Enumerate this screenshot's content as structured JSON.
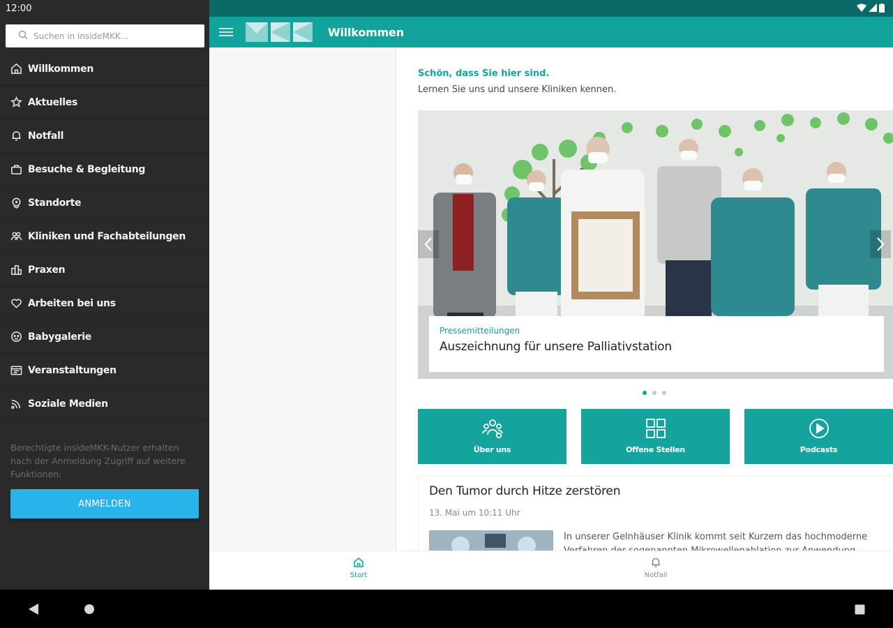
{
  "status": {
    "time": "12:00"
  },
  "search": {
    "placeholder": "Suchen in insideMKK..."
  },
  "nav": {
    "items": [
      {
        "label": "Willkommen",
        "icon": "home-icon"
      },
      {
        "label": "Aktuelles",
        "icon": "star-icon"
      },
      {
        "label": "Notfall",
        "icon": "bell-icon"
      },
      {
        "label": "Besuche & Begleitung",
        "icon": "bag-icon"
      },
      {
        "label": "Standorte",
        "icon": "location-icon"
      },
      {
        "label": "Kliniken und Fachabteilungen",
        "icon": "group-icon"
      },
      {
        "label": "Praxen",
        "icon": "building-icon"
      },
      {
        "label": "Arbeiten bei uns",
        "icon": "heart-icon"
      },
      {
        "label": "Babygalerie",
        "icon": "baby-icon"
      },
      {
        "label": "Veranstaltungen",
        "icon": "calendar-icon"
      },
      {
        "label": "Soziale Medien",
        "icon": "social-icon"
      }
    ]
  },
  "drawer": {
    "info": "Berechtigte insideMKK-Nutzer erhalten nach der Anmeldung Zugriff auf weitere Funktionen:",
    "login_label": "ANMELDEN"
  },
  "appbar": {
    "title": "Willkommen"
  },
  "welcome": {
    "headline": "Schön, dass Sie hier sind.",
    "subline": "Lernen Sie uns und unsere Kliniken kennen."
  },
  "carousel": {
    "category": "Pressemitteilungen",
    "title": "Auszeichnung für unsere Palliativstation",
    "slide_count": 3,
    "active_index": 0
  },
  "tiles": [
    {
      "label": "Über uns",
      "icon": "about-us-icon"
    },
    {
      "label": "Offene Stellen",
      "icon": "grid-icon"
    },
    {
      "label": "Podcasts",
      "icon": "play-icon"
    }
  ],
  "article": {
    "title": "Den Tumor durch Hitze zerstören",
    "date": "13. Mai um 10:11 Uhr",
    "excerpt": "In unserer Gelnhäuser Klinik kommt seit Kurzem das hochmoderne Verfahren der sogenannten Mikrowellenablation zur Anwendung"
  },
  "bottom_nav": [
    {
      "label": "Start",
      "icon": "home-icon",
      "active": true
    },
    {
      "label": "Notfall",
      "icon": "bell-icon",
      "active": false
    }
  ],
  "colors": {
    "primary": "#12a39d",
    "primary_dark": "#0b6a67",
    "drawer_bg": "#2a2a2a",
    "login_button": "#29b3ea"
  }
}
